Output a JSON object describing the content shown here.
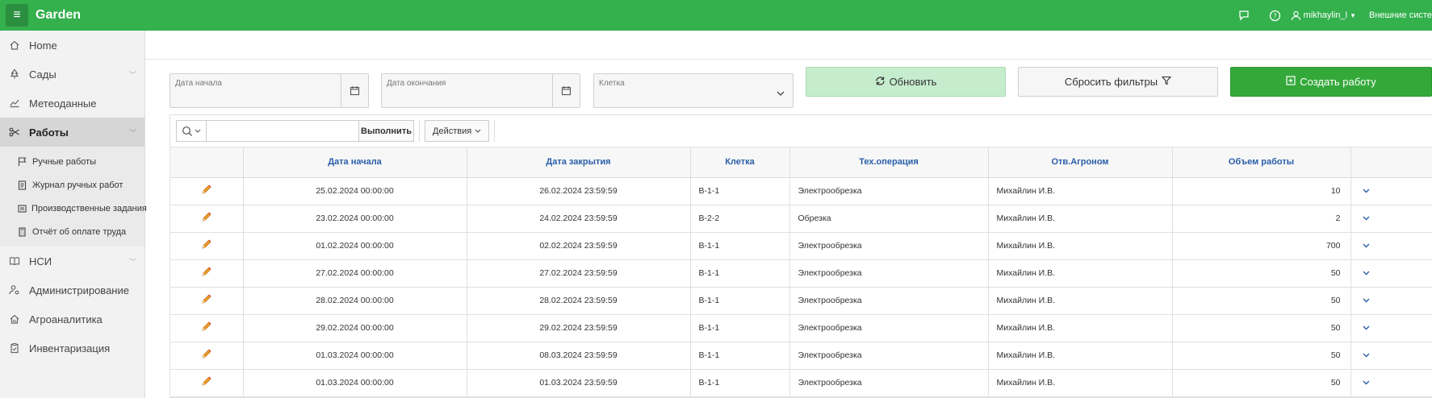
{
  "app": {
    "title": "Garden",
    "menu_icon": "hamburger-icon"
  },
  "header": {
    "username": "mikhaylin_l",
    "external_systems": "Внешние систем",
    "colors": {
      "brand_green": "#34b04d"
    }
  },
  "sidebar": {
    "items": [
      {
        "label": "Home",
        "icon": "home-icon"
      },
      {
        "label": "Сады",
        "icon": "tree-icon"
      },
      {
        "label": "Метеоданные",
        "icon": "chart-line-icon"
      },
      {
        "label": "Работы",
        "icon": "scissors-icon"
      },
      {
        "label": "НСИ",
        "icon": "book-icon"
      },
      {
        "label": "Администрирование",
        "icon": "user-cog-icon"
      },
      {
        "label": "Агроаналитика",
        "icon": "analytics-home-icon"
      },
      {
        "label": "Инвентаризация",
        "icon": "clipboard-icon"
      }
    ],
    "sub_items": [
      {
        "label": "Ручные работы",
        "icon": "flag-icon"
      },
      {
        "label": "Журнал ручных работ",
        "icon": "journal-icon"
      },
      {
        "label": "Производственные задания",
        "icon": "tasks-icon"
      },
      {
        "label": "Отчёт об оплате труда",
        "icon": "calculator-icon"
      }
    ]
  },
  "filters": {
    "start_date_label": "Дата начала",
    "end_date_label": "Дата окончания",
    "cell_label": "Клетка",
    "refresh_label": "Обновить",
    "reset_label": "Сбросить фильтры",
    "create_label": "Создать работу"
  },
  "toolbar": {
    "search_value": "",
    "run_label": "Выполнить",
    "actions_label": "Действия"
  },
  "table": {
    "columns": [
      "Дата начала",
      "Дата закрытия",
      "Клетка",
      "Тех.операция",
      "Отв.Агроном",
      "Объем работы"
    ],
    "rows": [
      {
        "start": "25.02.2024 00:00:00",
        "end": "26.02.2024 23:59:59",
        "cell": "В-1-1",
        "op": "Электрообрезка",
        "agronom": "Михайлин И.В.",
        "volume": "10"
      },
      {
        "start": "23.02.2024 00:00:00",
        "end": "24.02.2024 23:59:59",
        "cell": "В-2-2",
        "op": "Обрезка",
        "agronom": "Михайлин И.В.",
        "volume": "2"
      },
      {
        "start": "01.02.2024 00:00:00",
        "end": "02.02.2024 23:59:59",
        "cell": "В-1-1",
        "op": "Электрообрезка",
        "agronom": "Михайлин И.В.",
        "volume": "700"
      },
      {
        "start": "27.02.2024 00:00:00",
        "end": "27.02.2024 23:59:59",
        "cell": "В-1-1",
        "op": "Электрообрезка",
        "agronom": "Михайлин И.В.",
        "volume": "50"
      },
      {
        "start": "28.02.2024 00:00:00",
        "end": "28.02.2024 23:59:59",
        "cell": "В-1-1",
        "op": "Электрообрезка",
        "agronom": "Михайлин И.В.",
        "volume": "50"
      },
      {
        "start": "29.02.2024 00:00:00",
        "end": "29.02.2024 23:59:59",
        "cell": "В-1-1",
        "op": "Электрообрезка",
        "agronom": "Михайлин И.В.",
        "volume": "50"
      },
      {
        "start": "01.03.2024 00:00:00",
        "end": "08.03.2024 23:59:59",
        "cell": "В-1-1",
        "op": "Электрообрезка",
        "agronom": "Михайлин И.В.",
        "volume": "50"
      },
      {
        "start": "01.03.2024 00:00:00",
        "end": "01.03.2024 23:59:59",
        "cell": "В-1-1",
        "op": "Электрообрезка",
        "agronom": "Михайлин И.В.",
        "volume": "50"
      }
    ]
  }
}
